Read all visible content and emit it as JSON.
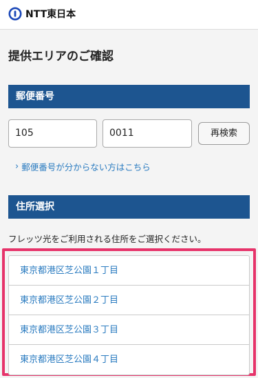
{
  "header": {
    "logo_text": "NTT東日本",
    "logo_icon": "ntt-logo-icon"
  },
  "page": {
    "title": "提供エリアのご確認"
  },
  "postal": {
    "section_title": "郵便番号",
    "first_value": "105",
    "second_value": "0011",
    "research_label": "再検索",
    "unknown_link": "郵便番号が分からない方はこちら"
  },
  "address": {
    "section_title": "住所選択",
    "description": "フレッツ光をご利用される住所をご選択ください。",
    "items": [
      {
        "label": "東京都港区芝公園１丁目"
      },
      {
        "label": "東京都港区芝公園２丁目"
      },
      {
        "label": "東京都港区芝公園３丁目"
      },
      {
        "label": "東京都港区芝公園４丁目"
      }
    ]
  },
  "colors": {
    "section_bar": "#1d5590",
    "link": "#2a7bc0",
    "highlight": "#e6336a"
  }
}
